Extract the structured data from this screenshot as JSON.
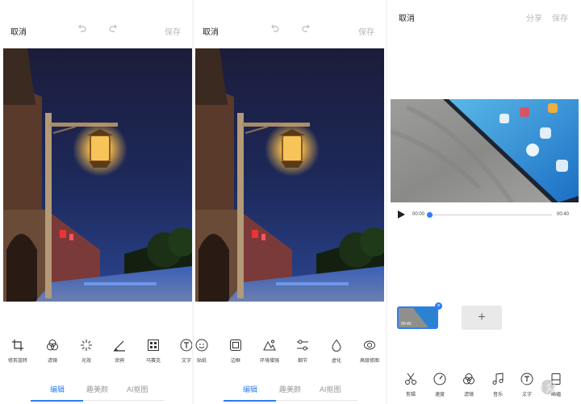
{
  "colors": {
    "accent": "#2f7df6",
    "disabled": "#b8b8b8"
  },
  "editor_left": {
    "cancel": "取消",
    "save": "保存",
    "tools": [
      {
        "label": "修剪旋转",
        "icon": "crop-icon"
      },
      {
        "label": "滤镜",
        "icon": "filter-icon"
      },
      {
        "label": "光效",
        "icon": "light-effect-icon"
      },
      {
        "label": "涂鸦",
        "icon": "brush-icon"
      },
      {
        "label": "马赛克",
        "icon": "mosaic-icon"
      },
      {
        "label": "文字",
        "icon": "text-icon"
      }
    ],
    "tabs": [
      {
        "label": "编辑",
        "active": true
      },
      {
        "label": "趣美颜",
        "active": false
      },
      {
        "label": "AI抠图",
        "active": false
      }
    ]
  },
  "editor_middle": {
    "cancel": "取消",
    "save": "保存",
    "tools": [
      {
        "label": "贴纸",
        "icon": "sticker-icon"
      },
      {
        "label": "边框",
        "icon": "frame-icon"
      },
      {
        "label": "环境增强",
        "icon": "enhance-icon"
      },
      {
        "label": "细节",
        "icon": "adjust-icon"
      },
      {
        "label": "虚化",
        "icon": "blur-icon"
      },
      {
        "label": "高级修图",
        "icon": "advanced-retouch-icon"
      }
    ],
    "tabs": [
      {
        "label": "编辑",
        "active": true
      },
      {
        "label": "趣美颜",
        "active": false
      },
      {
        "label": "AI抠图",
        "active": false
      }
    ]
  },
  "video_editor": {
    "cancel": "取消",
    "share": "分享",
    "save": "保存",
    "time_start": "00:00",
    "time_end": "00:40",
    "progress": 0,
    "clip_duration": "00:40",
    "add_clip": "+",
    "tools": [
      {
        "label": "剪辑",
        "icon": "scissors-icon"
      },
      {
        "label": "速度",
        "icon": "speed-icon"
      },
      {
        "label": "滤镜",
        "icon": "filter-icon"
      },
      {
        "label": "音乐",
        "icon": "music-icon"
      },
      {
        "label": "文字",
        "icon": "text-icon"
      },
      {
        "label": "画幅",
        "icon": "aspect-ratio-icon"
      }
    ]
  },
  "watermark": "新浪众测"
}
